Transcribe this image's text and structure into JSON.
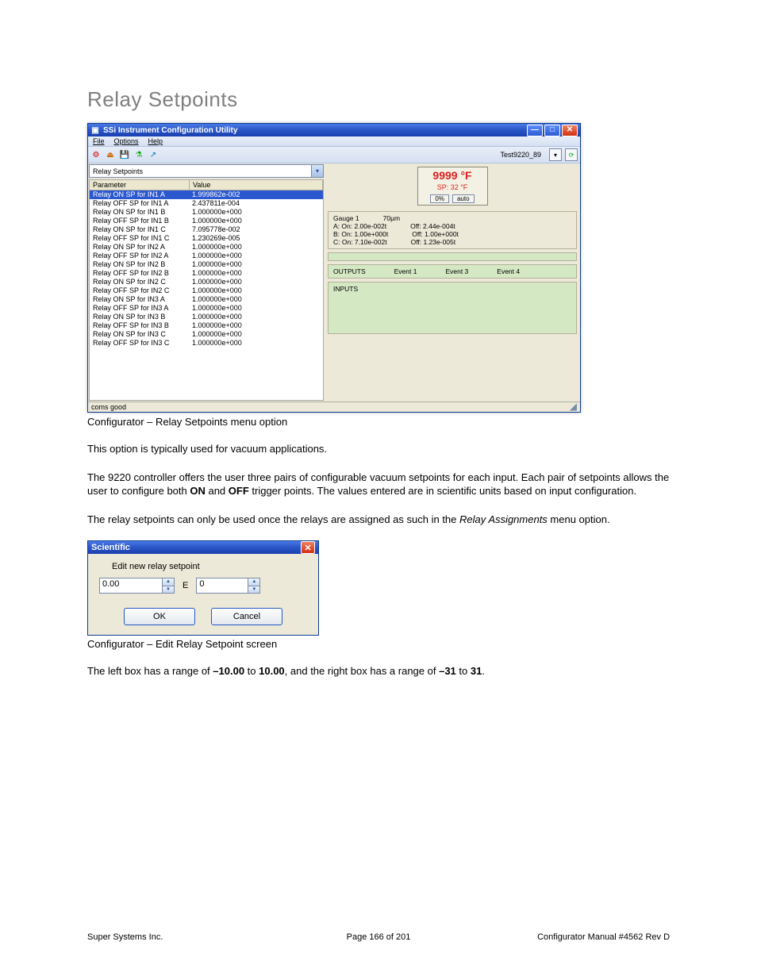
{
  "page_heading": "Relay Setpoints",
  "app": {
    "title": "SSi Instrument Configuration Utility",
    "menu": {
      "file": "File",
      "options": "Options",
      "help": "Help"
    },
    "system_name": "Test9220_89",
    "combo_label": "Relay Setpoints",
    "table": {
      "header_param": "Parameter",
      "header_value": "Value",
      "rows": [
        {
          "p": "Relay ON SP for IN1 A",
          "v": "1.999862e-002",
          "sel": true
        },
        {
          "p": "Relay OFF SP for IN1 A",
          "v": "2.437811e-004"
        },
        {
          "p": "Relay ON SP for IN1 B",
          "v": "1.000000e+000"
        },
        {
          "p": "Relay OFF SP for IN1 B",
          "v": "1.000000e+000"
        },
        {
          "p": "Relay ON SP for IN1 C",
          "v": "7.095778e-002"
        },
        {
          "p": "Relay OFF SP for IN1 C",
          "v": "1.230269e-005"
        },
        {
          "p": "Relay ON SP for IN2 A",
          "v": "1.000000e+000"
        },
        {
          "p": "Relay OFF SP for IN2 A",
          "v": "1.000000e+000"
        },
        {
          "p": "Relay ON SP for IN2 B",
          "v": "1.000000e+000"
        },
        {
          "p": "Relay OFF SP for IN2 B",
          "v": "1.000000e+000"
        },
        {
          "p": "Relay ON SP for IN2 C",
          "v": "1.000000e+000"
        },
        {
          "p": "Relay OFF SP for IN2 C",
          "v": "1.000000e+000"
        },
        {
          "p": "Relay ON SP for IN3 A",
          "v": "1.000000e+000"
        },
        {
          "p": "Relay OFF SP for IN3 A",
          "v": "1.000000e+000"
        },
        {
          "p": "Relay ON SP for IN3 B",
          "v": "1.000000e+000"
        },
        {
          "p": "Relay OFF SP for IN3 B",
          "v": "1.000000e+000"
        },
        {
          "p": "Relay ON SP for IN3 C",
          "v": "1.000000e+000"
        },
        {
          "p": "Relay OFF SP for IN3 C",
          "v": "1.000000e+000"
        }
      ]
    },
    "readout": {
      "temp": "9999 °F",
      "sp": "SP: 32 °F",
      "pct": "0%",
      "mode": "auto"
    },
    "gauge": {
      "title": "Gauge 1",
      "unit": "70µm",
      "lines": [
        {
          "l": "A: On: 2.00e-002t",
          "r": "Off: 2.44e-004t"
        },
        {
          "l": "B: On: 1.00e+000t",
          "r": "Off: 1.00e+000t"
        },
        {
          "l": "C: On: 7.10e-002t",
          "r": "Off: 1.23e-005t"
        }
      ]
    },
    "outputs": {
      "label": "OUTPUTS",
      "e1": "Event 1",
      "e3": "Event 3",
      "e4": "Event 4"
    },
    "inputs": {
      "label": "INPUTS"
    },
    "status": "coms good"
  },
  "caption1": "Configurator – Relay Setpoints menu option",
  "para1": "This option is typically used for vacuum applications.",
  "para2a": "The 9220 controller offers the user three pairs of configurable vacuum setpoints for each input. Each pair of setpoints allows the user to configure both ",
  "para2b_on": "ON",
  "para2c": " and ",
  "para2d_off": "OFF",
  "para2e": " trigger points. The values entered are in scientific units based on input configuration.",
  "para3a": "The relay setpoints can only be used once the relays are assigned as such in the ",
  "para3b_italic": "Relay Assignments",
  "para3c": " menu option.",
  "dialog": {
    "title": "Scientific",
    "prompt": "Edit new relay setpoint",
    "val1": "0.00",
    "elabel": "E",
    "val2": "0",
    "ok": "OK",
    "cancel": "Cancel"
  },
  "caption2": "Configurator – Edit Relay Setpoint screen",
  "para4a": "The left box has a range of ",
  "para4b": "–10.00",
  "para4c": " to ",
  "para4d": "10.00",
  "para4e": ", and the right box has a range of ",
  "para4f": "–31",
  "para4g": " to ",
  "para4h": "31",
  "para4i": ".",
  "footer": {
    "left": "Super Systems Inc.",
    "center": "Page 166 of 201",
    "right": "Configurator Manual #4562 Rev D"
  }
}
